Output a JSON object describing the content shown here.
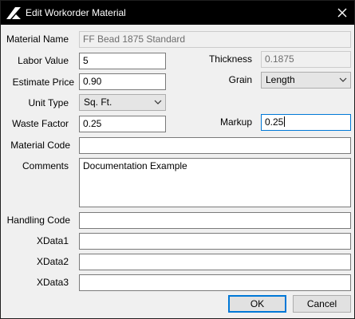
{
  "window": {
    "title": "Edit Workorder Material"
  },
  "icons": {
    "app": "app-logo-icon",
    "close": "close-icon",
    "dropdown": "chevron-down-icon"
  },
  "colors": {
    "titlebar": "#000000",
    "focus_border": "#0078d7",
    "background": "#f0f0f0"
  },
  "form": {
    "material_name": {
      "label": "Material Name",
      "value": "FF Bead 1875 Standard"
    },
    "labor_value": {
      "label": "Labor Value",
      "value": "5"
    },
    "thickness": {
      "label": "Thickness",
      "value": "0.1875"
    },
    "estimate_price": {
      "label": "Estimate Price",
      "value": "0.90"
    },
    "grain": {
      "label": "Grain",
      "value": "Length"
    },
    "unit_type": {
      "label": "Unit Type",
      "value": "Sq. Ft."
    },
    "waste_factor": {
      "label": "Waste Factor",
      "value": "0.25"
    },
    "markup": {
      "label": "Markup",
      "value": "0.25"
    },
    "material_code": {
      "label": "Material Code",
      "value": ""
    },
    "comments": {
      "label": "Comments",
      "value": "Documentation Example"
    },
    "handling_code": {
      "label": "Handling Code",
      "value": ""
    },
    "xdata1": {
      "label": "XData1",
      "value": ""
    },
    "xdata2": {
      "label": "XData2",
      "value": ""
    },
    "xdata3": {
      "label": "XData3",
      "value": ""
    }
  },
  "buttons": {
    "ok": "OK",
    "cancel": "Cancel"
  }
}
